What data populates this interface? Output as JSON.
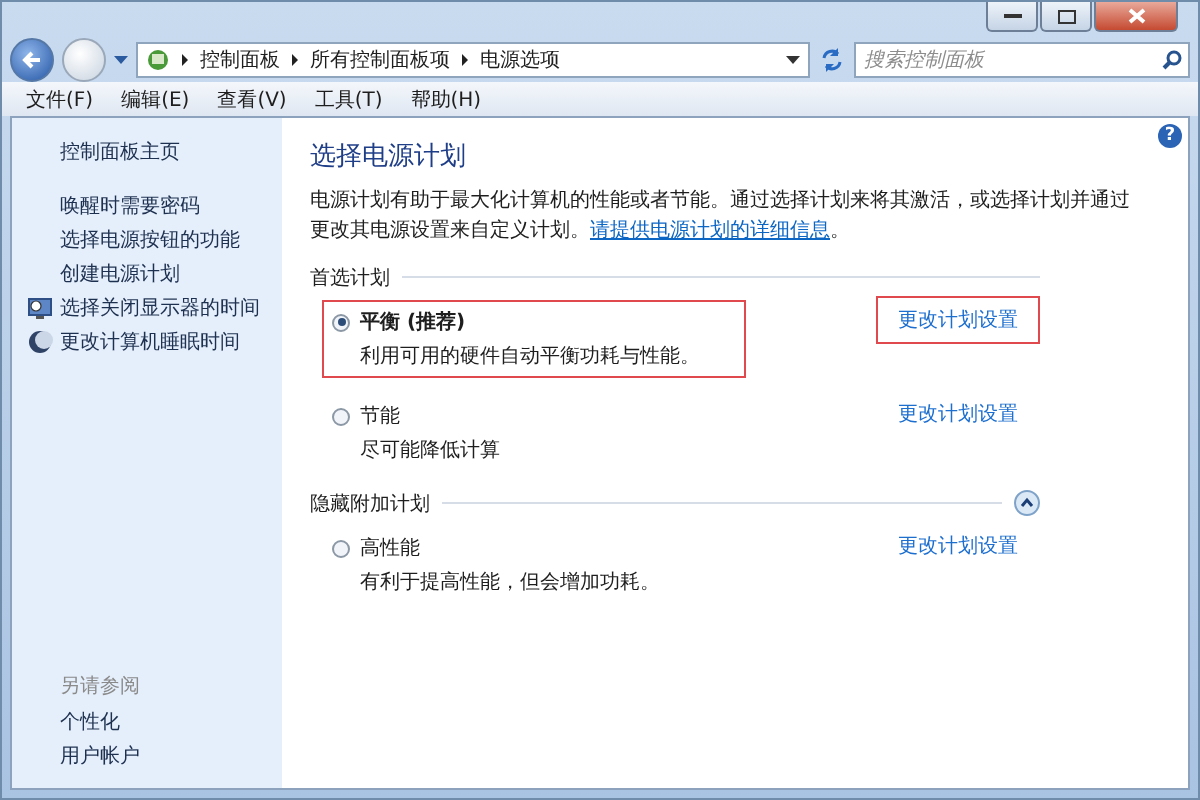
{
  "address_bar": {
    "breadcrumbs": [
      "控制面板",
      "所有控制面板项",
      "电源选项"
    ],
    "search": {
      "placeholder": "搜索控制面板"
    }
  },
  "menu": [
    "文件(F)",
    "编辑(E)",
    "查看(V)",
    "工具(T)",
    "帮助(H)"
  ],
  "sidebar": {
    "home": "控制面板主页",
    "items": [
      {
        "label": "唤醒时需要密码",
        "kind": "plain"
      },
      {
        "label": "选择电源按钮的功能",
        "kind": "plain"
      },
      {
        "label": "创建电源计划",
        "kind": "plain"
      },
      {
        "label": "选择关闭显示器的时间",
        "kind": "display"
      },
      {
        "label": "更改计算机睡眠时间",
        "kind": "sleep"
      }
    ],
    "see_also": {
      "title": "另请参阅",
      "items": [
        "个性化",
        "用户帐户"
      ]
    }
  },
  "main": {
    "help_button": "?",
    "heading": "选择电源计划",
    "description": "电源计划有助于最大化计算机的性能或者节能。通过选择计划来将其激活，或选择计划并通过更改其电源设置来自定义计划。",
    "description_link": "请提供电源计划的详细信息",
    "description_end": "。",
    "groups": [
      {
        "title": "首选计划",
        "plans": [
          {
            "name": "平衡 (推荐)",
            "description": "利用可用的硬件自动平衡功耗与性能。",
            "selected": true,
            "highlighted": true,
            "link": "更改计划设置",
            "link_highlighted": true
          },
          {
            "name": "节能",
            "description": "尽可能降低计算",
            "selected": false,
            "highlighted": false,
            "link": "更改计划设置",
            "link_highlighted": false
          }
        ]
      },
      {
        "title": "隐藏附加计划",
        "expanded": true,
        "plans": [
          {
            "name": "高性能",
            "description": "有利于提高性能，但会增加功耗。",
            "selected": false,
            "highlighted": false,
            "link": "更改计划设置",
            "link_highlighted": false
          }
        ]
      }
    ]
  }
}
